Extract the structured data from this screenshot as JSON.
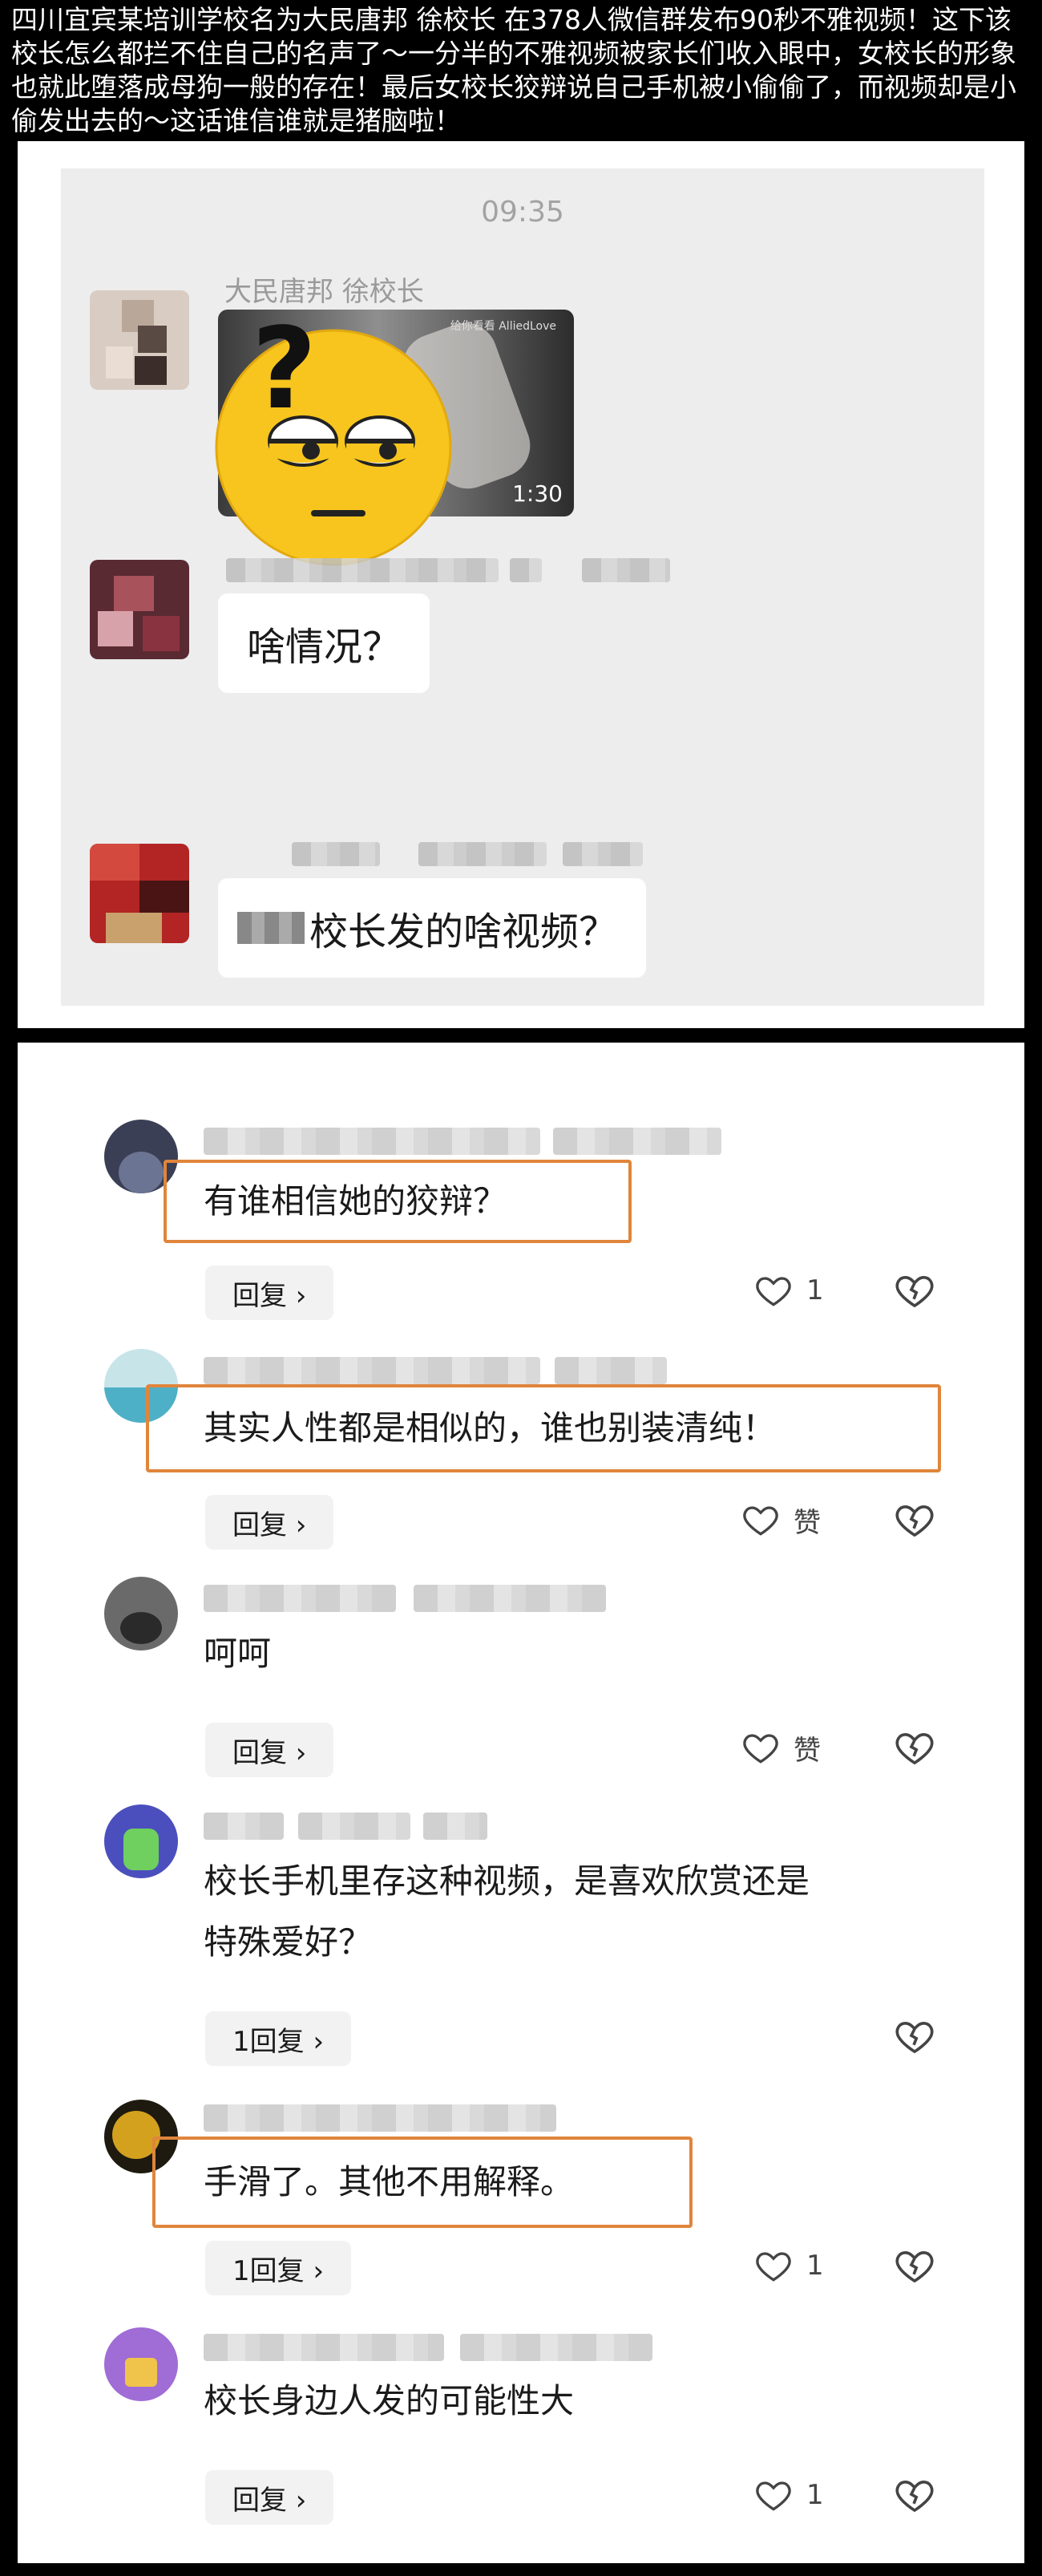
{
  "headline": "四川宜宾某培训学校名为大民唐邦 徐校长 在378人微信群发布90秒不雅视频！这下该校长怎么都拦不住自己的名声了～一分半的不雅视频被家长们收入眼中，女校长的形象也就此堕落成母狗一般的存在！最后女校长狡辩说自己手机被小偷偷了，而视频却是小偷发出去的～这话谁信谁就是猪脑啦！",
  "chat": {
    "time": "09:35",
    "messages": [
      {
        "sender": "大民唐邦 徐校长",
        "video_duration": "1:30",
        "video_caption": "给你看看 AlliedLove"
      },
      {
        "text": "啥情况？"
      },
      {
        "text": "校长发的啥视频？"
      }
    ]
  },
  "comments": [
    {
      "text": "有谁相信她的狡辩？",
      "reply": "回复 ›",
      "likes": "1",
      "highlighted": true
    },
    {
      "text": "其实人性都是相似的，谁也别装清纯！",
      "reply": "回复 ›",
      "likes": "赞",
      "highlighted": true
    },
    {
      "text": "呵呵",
      "reply": "回复 ›",
      "likes": "赞",
      "highlighted": false
    },
    {
      "text_line1": "校长手机里存这种视频，是喜欢欣赏还是",
      "text_line2": "特殊爱好？",
      "reply": "1回复 ›",
      "likes": "",
      "highlighted": false
    },
    {
      "text": "手滑了。其他不用解释。",
      "reply": "1回复 ›",
      "likes": "1",
      "highlighted": true
    },
    {
      "text": "校长身边人发的可能性大",
      "reply": "回复 ›",
      "likes": "1",
      "highlighted": false
    }
  ],
  "colors": {
    "highlight_border": "#e0853b",
    "emoji_yellow": "#f7c51e",
    "chat_background": "#ededed"
  },
  "icons": [
    "question-mark-emoji-icon",
    "heart-icon",
    "broken-heart-icon"
  ]
}
